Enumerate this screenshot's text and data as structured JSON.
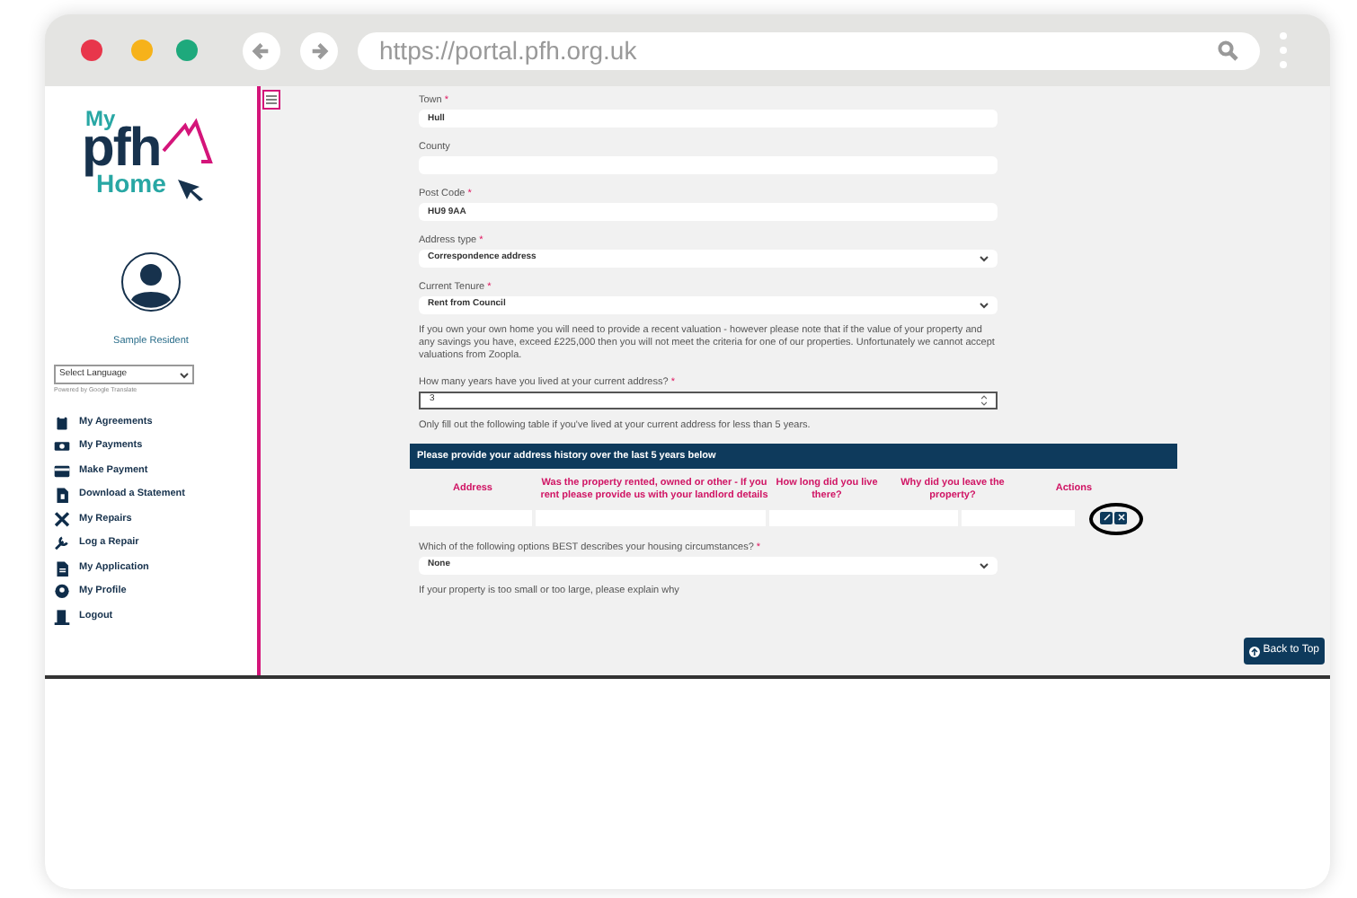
{
  "browser": {
    "url": "https://portal.pfh.org.uk"
  },
  "sidebar": {
    "logo": {
      "line_1": "My",
      "line_2": "pfh",
      "line_3": "Home"
    },
    "user_name": "Sample Resident",
    "language_select": {
      "value": "Select Language"
    },
    "powered_by": "Powered by Google Translate",
    "nav_items": [
      {
        "label": "My Agreements"
      },
      {
        "label": "My Payments"
      },
      {
        "label": "Make Payment"
      },
      {
        "label": "Download a Statement"
      },
      {
        "label": "My Repairs"
      },
      {
        "label": "Log a Repair"
      },
      {
        "label": "My Application"
      },
      {
        "label": "My Profile"
      },
      {
        "label": "Logout"
      }
    ]
  },
  "form": {
    "items": [
      {
        "kind": "text",
        "label": "Town",
        "required_mark": "*",
        "value": "Hull"
      },
      {
        "kind": "text",
        "label": "County"
      },
      {
        "kind": "text",
        "label": "Post Code",
        "required_mark": "*",
        "value": "HU9 9AA"
      },
      {
        "kind": "select",
        "label": "Address type",
        "required_mark": "*",
        "value": "Correspondence address"
      },
      {
        "kind": "select",
        "label": "Current Tenure",
        "required_mark": "*",
        "value": "Rent from Council"
      },
      {
        "kind": "note",
        "text": "If you own your own home you will need to provide a recent valuation - however please note that if the value of your property and any savings you have, exceed £225,000 then you will not meet the criteria for one of our properties. Unfortunately we cannot accept valuations from Zoopla."
      },
      {
        "kind": "number",
        "label": "How many years have you lived at your current address?",
        "required_mark": "*",
        "value": "3"
      },
      {
        "kind": "note",
        "text": "Only fill out the following table if you've lived at your current address for less than 5 years."
      },
      {
        "kind": "table",
        "title": "Please provide your address history over the last 5 years below",
        "columns": [
          "Address",
          "Was the property rented, owned or other - If you rent please provide us with your landlord details",
          "How long did you live there?",
          "Why did you leave the property?",
          "Actions"
        ]
      },
      {
        "kind": "select",
        "label": "Which of the following options BEST describes your housing circumstances?",
        "required_mark": "*",
        "value": "None"
      },
      {
        "kind": "note",
        "text": "If your property is too small or too large, please explain why"
      }
    ]
  },
  "back_to_top": "Back to Top"
}
